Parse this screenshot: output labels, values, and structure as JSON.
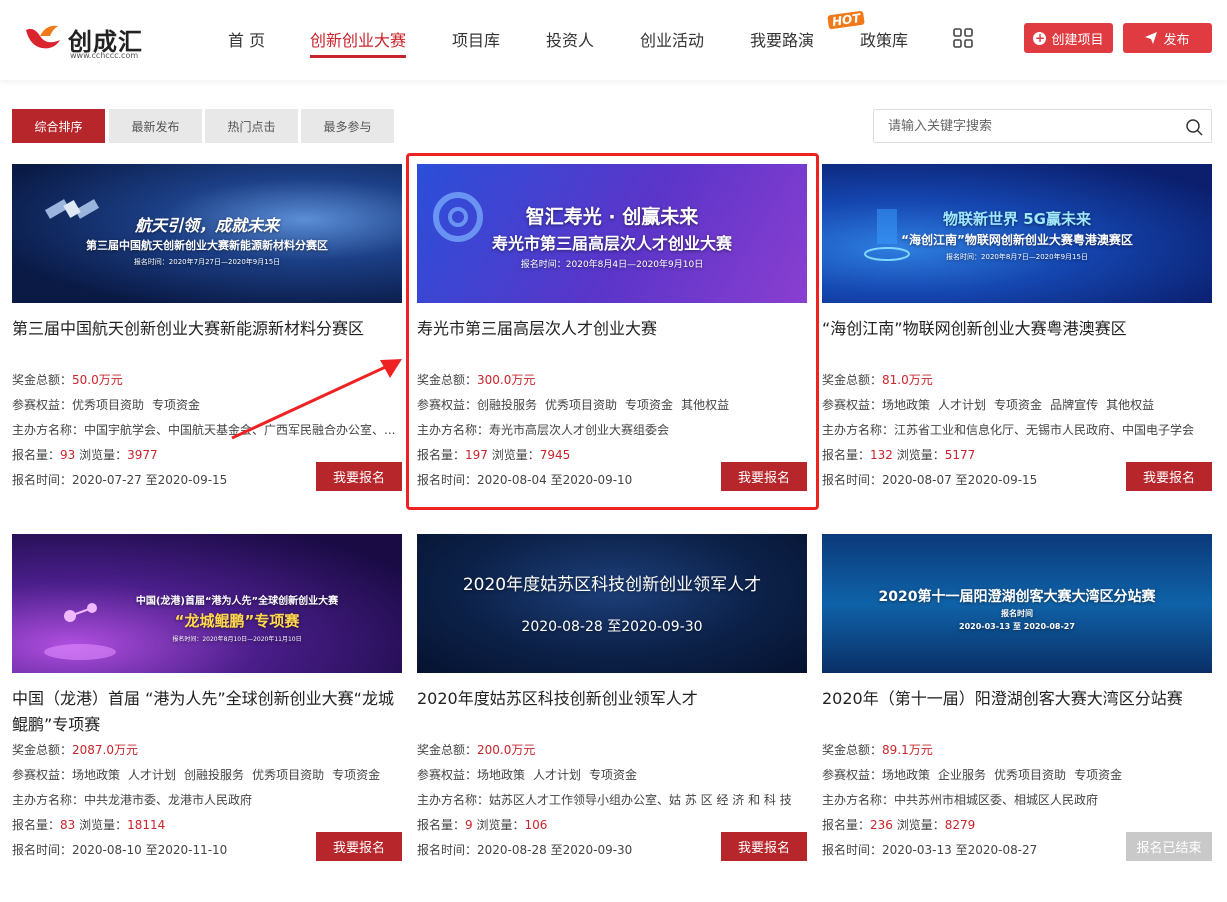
{
  "header": {
    "logo_name": "创成汇",
    "logo_url": "www.cchccc.com",
    "nav": [
      {
        "label": "首 页"
      },
      {
        "label": "创新创业大赛"
      },
      {
        "label": "项目库"
      },
      {
        "label": "投资人"
      },
      {
        "label": "创业活动"
      },
      {
        "label": "我要路演"
      },
      {
        "label": "政策库"
      }
    ],
    "hot_badge": "HOT",
    "create_label": "创建项目",
    "publish_label": "发布"
  },
  "sort_tabs": [
    "综合排序",
    "最新发布",
    "热门点击",
    "最多参与"
  ],
  "search": {
    "placeholder": "请输入关键字搜索"
  },
  "labels": {
    "prize": "奖金总额：",
    "benefits": "参赛权益：",
    "organizer": "主办方名称：",
    "signups": "报名量：",
    "views": "浏览量：",
    "period": "报名时间："
  },
  "cards": [
    {
      "banner_line1": "航天引领，成就未来",
      "banner_line2": "第三届中国航天创新创业大赛新能源新材料分赛区",
      "banner_line3": "报名时间：2020年7月27日—2020年9月15日",
      "title": "第三届中国航天创新创业大赛新能源新材料分赛区",
      "prize": "50.0万元",
      "benefits": [
        "优秀项目资助",
        "专项资金"
      ],
      "organizer": "中国宇航学会、中国航天基金会、广西军民融合办公室、...",
      "signups": "93",
      "views": "3977",
      "period": "2020-07-27 至2020-09-15",
      "button": "我要报名"
    },
    {
      "banner_line1": "智汇寿光 · 创赢未来",
      "banner_line2": "寿光市第三届高层次人才创业大赛",
      "banner_line3": "报名时间：2020年8月4日—2020年9月10日",
      "title": "寿光市第三届高层次人才创业大赛",
      "prize": "300.0万元",
      "benefits": [
        "创融投服务",
        "优秀项目资助",
        "专项资金",
        "其他权益"
      ],
      "organizer": "寿光市高层次人才创业大赛组委会",
      "signups": "197",
      "views": "7945",
      "period": "2020-08-04 至2020-09-10",
      "button": "我要报名"
    },
    {
      "banner_line1": "物联新世界  5G赢未来",
      "banner_line2": "“海创江南”物联网创新创业大赛粤港澳赛区",
      "banner_line3": "报名时间：2020年8月7日—2020年9月15日",
      "title": "“海创江南”物联网创新创业大赛粤港澳赛区",
      "prize": "81.0万元",
      "benefits": [
        "场地政策",
        "人才计划",
        "专项资金",
        "品牌宣传",
        "其他权益"
      ],
      "organizer": "江苏省工业和信息化厅、无锡市人民政府、中国电子学会",
      "signups": "132",
      "views": "5177",
      "period": "2020-08-07 至2020-09-15",
      "button": "我要报名"
    },
    {
      "banner_line1": "中国(龙港)首届“港为人先”全球创新创业大赛",
      "banner_line2": "“龙城鲲鹏”专项赛",
      "banner_line3": "报名时间：2020年8月10日—2020年11月10日",
      "title": "中国（龙港）首届 “港为人先”全球创新创业大赛“龙城鲲鹏”专项赛",
      "prize": "2087.0万元",
      "benefits": [
        "场地政策",
        "人才计划",
        "创融投服务",
        "优秀项目资助",
        "专项资金"
      ],
      "organizer": "中共龙港市委、龙港市人民政府",
      "signups": "83",
      "views": "18114",
      "period": "2020-08-10 至2020-11-10",
      "button": "我要报名"
    },
    {
      "banner_line1": "2020年度姑苏区科技创新创业领军人才",
      "banner_line2": "2020-08-28 至2020-09-30",
      "banner_line3": "",
      "title": "2020年度姑苏区科技创新创业领军人才",
      "prize": "200.0万元",
      "benefits": [
        "场地政策",
        "人才计划",
        "专项资金"
      ],
      "organizer": "姑苏区人才工作领导小组办公室、姑 苏 区 经 济 和 科 技",
      "signups": "9",
      "views": "106",
      "period": "2020-08-28 至2020-09-30",
      "button": "我要报名"
    },
    {
      "banner_line1": "2020第十一届阳澄湖创客大赛大湾区分站赛",
      "banner_line2": "报名时间",
      "banner_line3": "2020-03-13 至 2020-08-27",
      "title": "2020年（第十一届）阳澄湖创客大赛大湾区分站赛",
      "prize": "89.1万元",
      "benefits": [
        "场地政策",
        "企业服务",
        "优秀项目资助",
        "专项资金"
      ],
      "organizer": "中共苏州市相城区委、相城区人民政府",
      "signups": "236",
      "views": "8279",
      "period": "2020-03-13 至2020-08-27",
      "button": "报名已结束"
    }
  ],
  "colors": {
    "accent": "#c9242b",
    "button": "#b7262b",
    "ended": "#c9c9c9",
    "highlight": "#ee2222"
  }
}
